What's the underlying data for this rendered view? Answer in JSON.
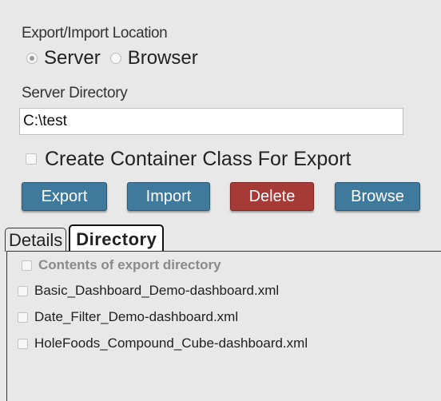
{
  "location": {
    "label": "Export/Import Location",
    "options": [
      {
        "label": "Server",
        "checked": true
      },
      {
        "label": "Browser",
        "checked": false
      }
    ]
  },
  "server_directory": {
    "label": "Server Directory",
    "value": "C:\\test"
  },
  "container_class": {
    "label": "Create Container Class For Export",
    "checked": false
  },
  "buttons": {
    "export": "Export",
    "import": "Import",
    "delete": "Delete",
    "browse": "Browse"
  },
  "tabs": [
    {
      "label": "Details",
      "active": false
    },
    {
      "label": "Directory",
      "active": true
    }
  ],
  "directory": {
    "header": "Contents of export directory",
    "files": [
      "Basic_Dashboard_Demo-dashboard.xml",
      "Date_Filter_Demo-dashboard.xml",
      "HoleFoods_Compound_Cube-dashboard.xml"
    ]
  },
  "colors": {
    "panel_bg": "#e8e8e8",
    "button_blue": "#3f7a9c",
    "button_red": "#a63a36"
  }
}
